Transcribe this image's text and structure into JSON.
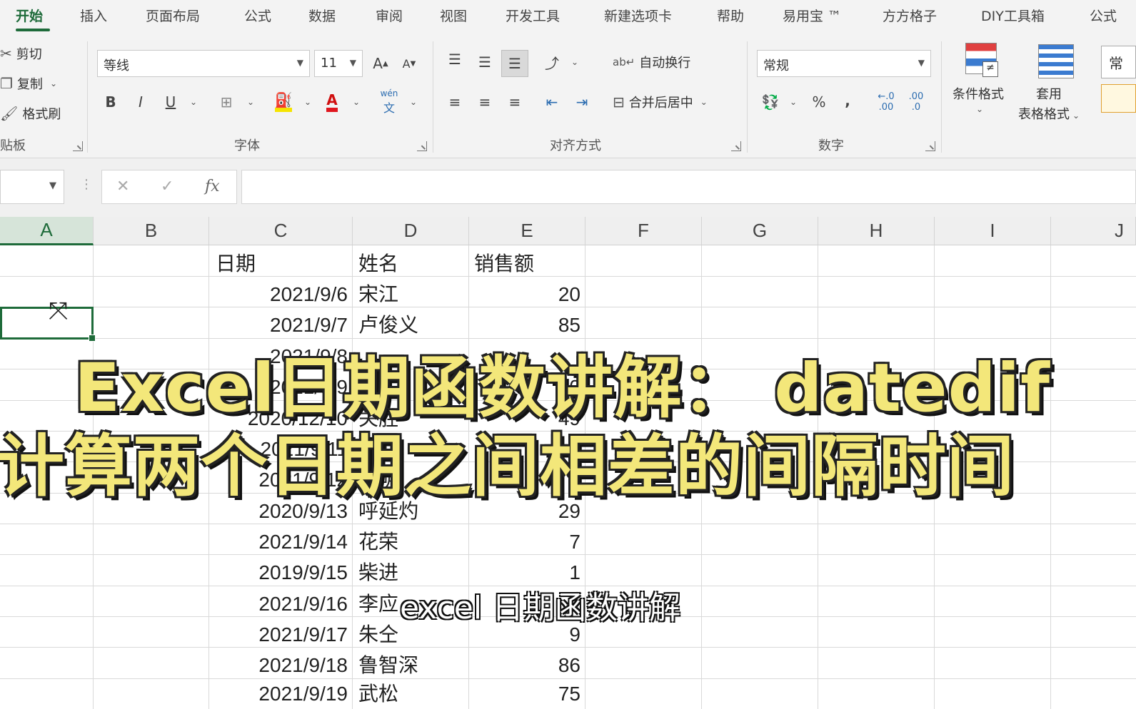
{
  "tabs": [
    "开始",
    "插入",
    "页面布局",
    "公式",
    "数据",
    "审阅",
    "视图",
    "开发工具",
    "新建选项卡",
    "帮助",
    "易用宝 ™",
    "方方格子",
    "DIY工具箱",
    "公式"
  ],
  "clipboard": {
    "cut": "剪切",
    "copy": "复制",
    "format_painter": "格式刷",
    "label": "贴板"
  },
  "font": {
    "name": "等线",
    "size": "11",
    "grow": "A",
    "shrink": "A",
    "bold": "B",
    "italic": "I",
    "underline": "U",
    "font_color_glyph": "A",
    "phonetic": "wén",
    "label": "字体"
  },
  "alignment": {
    "wrap_text": "自动换行",
    "merge_center": "合并后居中",
    "label": "对齐方式"
  },
  "number": {
    "format": "常规",
    "percent": "%",
    "comma": ",",
    "inc_decimal": ".00",
    "dec_decimal": ".0",
    "label": "数字"
  },
  "styles": {
    "conditional": "条件格式",
    "table_line1": "套用",
    "table_line2": "表格格式",
    "partial": "常"
  },
  "formula_bar": {
    "cancel": "✕",
    "enter": "✓",
    "fx": "fx"
  },
  "columns": [
    "A",
    "B",
    "C",
    "D",
    "E",
    "F",
    "G",
    "H",
    "I",
    "J"
  ],
  "sheet": {
    "headers": {
      "date": "日期",
      "name": "姓名",
      "sales": "销售额"
    },
    "rows": [
      {
        "date": "2021/9/6",
        "name": "宋江",
        "sales": "20"
      },
      {
        "date": "2021/9/7",
        "name": "卢俊义",
        "sales": "85"
      },
      {
        "date": "2021/9/8",
        "name": "",
        "sales": ""
      },
      {
        "date": "2021/9/9",
        "name": "",
        "sales": "80"
      },
      {
        "date": "2020/12/10",
        "name": "关胜",
        "sales": "49"
      },
      {
        "date": "2021/9/11",
        "name": "林冲",
        "sales": ""
      },
      {
        "date": "2021/9/12",
        "name": "秦明",
        "sales": ""
      },
      {
        "date": "2020/9/13",
        "name": "呼延灼",
        "sales": "29"
      },
      {
        "date": "2021/9/14",
        "name": "花荣",
        "sales": "7"
      },
      {
        "date": "2019/9/15",
        "name": "柴进",
        "sales": "1"
      },
      {
        "date": "2021/9/16",
        "name": "李应",
        "sales": ""
      },
      {
        "date": "2021/9/17",
        "name": "朱仝",
        "sales": "9"
      },
      {
        "date": "2021/9/18",
        "name": "鲁智深",
        "sales": "86"
      },
      {
        "date": "2021/9/19",
        "name": "武松",
        "sales": "75"
      }
    ]
  },
  "overlay": {
    "title_line1": "Excel日期函数讲解： datedif",
    "title_line2": "计算两个日期之间相差的间隔时间",
    "subtitle": "excel 日期函数讲解"
  }
}
